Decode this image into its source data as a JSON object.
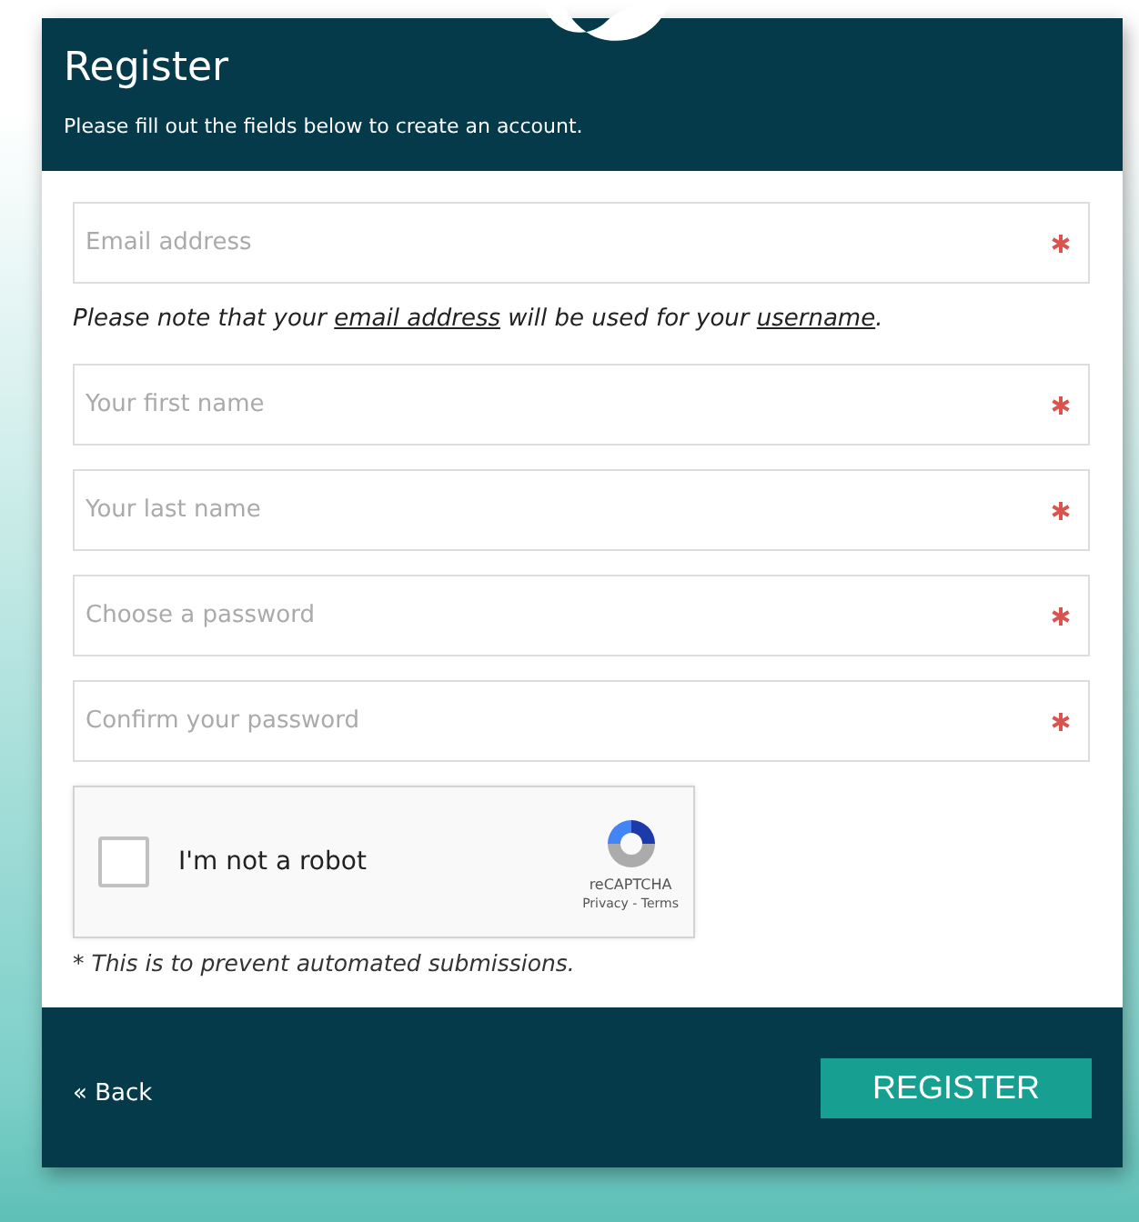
{
  "header": {
    "title": "Register",
    "subtitle": "Please fill out the fields below to create an account."
  },
  "fields": [
    {
      "placeholder": "Email address",
      "required": true
    },
    {
      "placeholder": "Your first name",
      "required": true
    },
    {
      "placeholder": "Your last name",
      "required": true
    },
    {
      "placeholder": "Choose a password",
      "required": true
    },
    {
      "placeholder": "Confirm your password",
      "required": true
    }
  ],
  "note": [
    {
      "kind": "plain",
      "text": "Please note that your "
    },
    {
      "kind": "link",
      "text": "email address"
    },
    {
      "kind": "plain",
      "text": " will be used for your "
    },
    {
      "kind": "link",
      "text": "username"
    },
    {
      "kind": "plain",
      "text": "."
    }
  ],
  "captcha": {
    "label": "I'm not a robot",
    "checked": false,
    "brand": "reCAPTCHA",
    "links": "Privacy - Terms"
  },
  "footnote": "* This is to prevent automated submissions.",
  "footer": {
    "back": "« Back",
    "submit": "REGISTER"
  }
}
